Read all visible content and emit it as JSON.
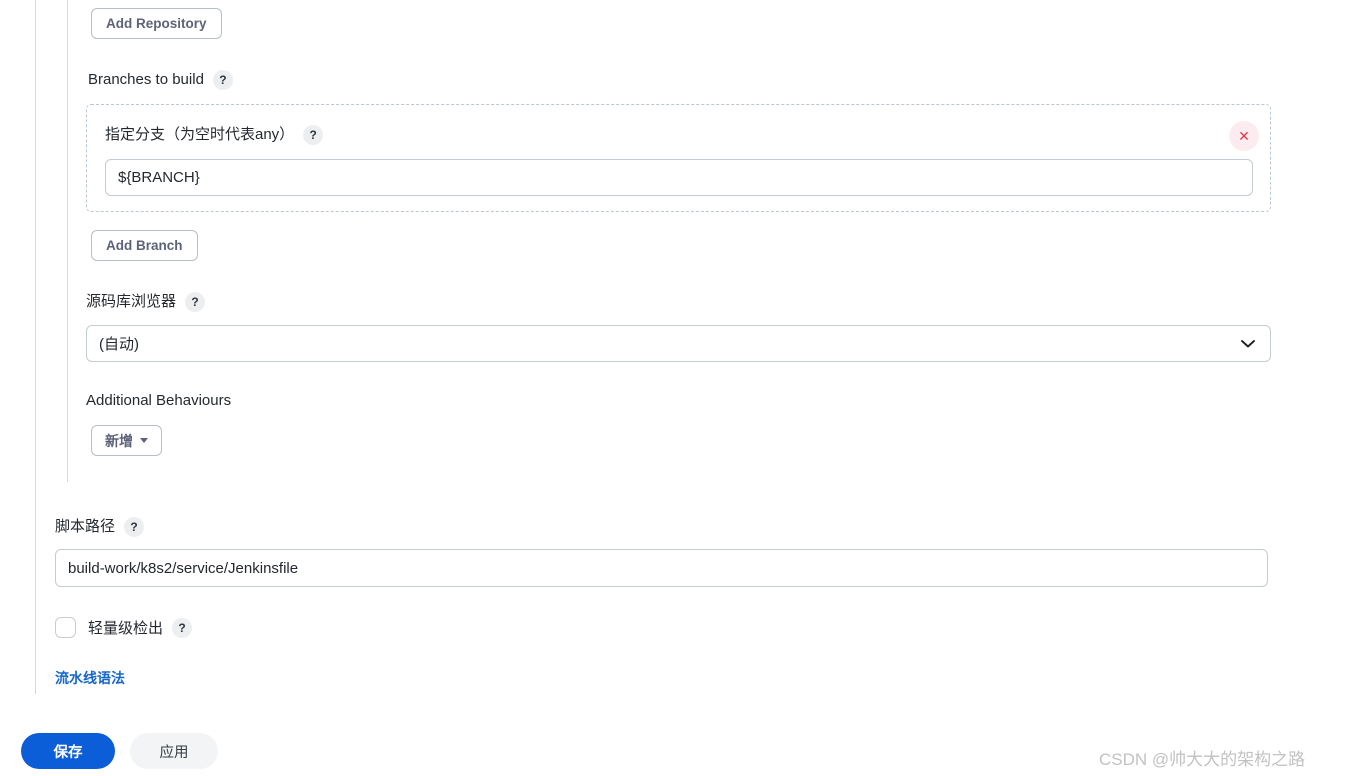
{
  "scm": {
    "add_repository_label": "Add Repository",
    "branches_to_build_label": "Branches to build",
    "branches_help_icon": "?",
    "branch_spec": {
      "label": "指定分支（为空时代表any）",
      "help_icon": "?",
      "value": "${BRANCH}",
      "delete_icon": "✕"
    },
    "add_branch_label": "Add Branch",
    "repo_browser": {
      "label": "源码库浏览器",
      "help_icon": "?",
      "selected": "(自动)",
      "chevron_icon": "chevron-down"
    },
    "additional_behaviours_label": "Additional Behaviours",
    "add_behaviour_label": "新增"
  },
  "pipeline": {
    "script_path_label": "脚本路径",
    "script_path_help_icon": "?",
    "script_path_value": "build-work/k8s2/service/Jenkinsfile",
    "lightweight_checkout_label": "轻量级检出",
    "lightweight_checkout_help_icon": "?",
    "lightweight_checkout_checked": false,
    "pipeline_syntax_link": "流水线语法"
  },
  "footer": {
    "save_label": "保存",
    "apply_label": "应用",
    "save_color": "#0b5ed7"
  },
  "watermark": "CSDN @帅大大的架构之路"
}
